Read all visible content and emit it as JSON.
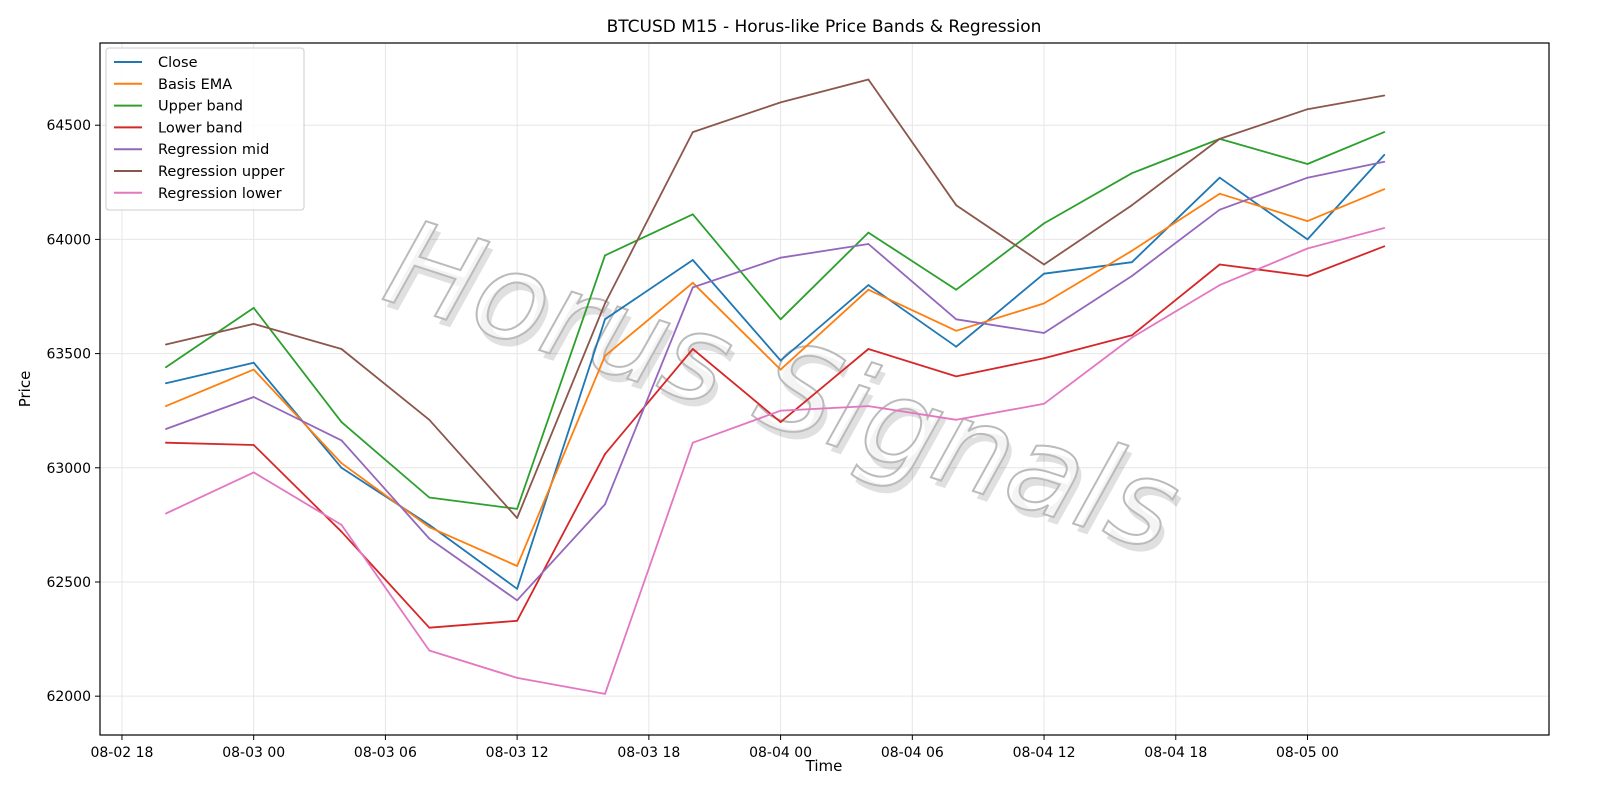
{
  "chart_data": {
    "type": "line",
    "title": "BTCUSD M15 - Horus-like Price Bands & Regression",
    "xlabel": "Time",
    "ylabel": "Price",
    "xlim": [
      "08-02 17:00",
      "08-05 11:00"
    ],
    "ylim": [
      61830,
      64860
    ],
    "x_ticks": [
      "08-02 18",
      "08-03 00",
      "08-03 06",
      "08-03 12",
      "08-03 18",
      "08-04 00",
      "08-04 06",
      "08-04 12",
      "08-04 18",
      "08-05 00"
    ],
    "y_ticks": [
      62000,
      62500,
      63000,
      63500,
      64000,
      64500
    ],
    "grid": true,
    "legend_position": "top-left",
    "watermark": "Horus Signals",
    "x": [
      "08-02 20:00",
      "08-03 00:00",
      "08-03 04:00",
      "08-03 08:00",
      "08-03 12:00",
      "08-03 16:00",
      "08-03 20:00",
      "08-04 00:00",
      "08-04 04:00",
      "08-04 08:00",
      "08-04 12:00",
      "08-04 16:00",
      "08-04 20:00",
      "08-05 00:00",
      "08-05 03:30"
    ],
    "series": [
      {
        "name": "Close",
        "color": "#1f77b4",
        "values": [
          63370,
          63460,
          63000,
          62750,
          62470,
          63650,
          63910,
          63470,
          63800,
          63530,
          63850,
          63900,
          64270,
          64000,
          64370
        ]
      },
      {
        "name": "Basis EMA",
        "color": "#ff7f0e",
        "values": [
          63270,
          63430,
          63020,
          62740,
          62570,
          63490,
          63810,
          63430,
          63780,
          63600,
          63720,
          63950,
          64200,
          64080,
          64220
        ]
      },
      {
        "name": "Upper band",
        "color": "#2ca02c",
        "values": [
          63440,
          63700,
          63200,
          62870,
          62820,
          63930,
          64110,
          63650,
          64030,
          63780,
          64070,
          64290,
          64440,
          64330,
          64470
        ]
      },
      {
        "name": "Lower band",
        "color": "#d62728",
        "values": [
          63110,
          63100,
          62720,
          62300,
          62330,
          63060,
          63520,
          63200,
          63520,
          63400,
          63480,
          63580,
          63890,
          63840,
          63970
        ]
      },
      {
        "name": "Regression mid",
        "color": "#9467bd",
        "values": [
          63170,
          63310,
          63120,
          62690,
          62420,
          62840,
          63790,
          63920,
          63980,
          63650,
          63590,
          63840,
          64130,
          64270,
          64340
        ]
      },
      {
        "name": "Regression upper",
        "color": "#8c564b",
        "values": [
          63540,
          63630,
          63520,
          63210,
          62780,
          63720,
          64470,
          64600,
          64700,
          64150,
          63890,
          64150,
          64440,
          64570,
          64630
        ]
      },
      {
        "name": "Regression lower",
        "color": "#e377c2",
        "values": [
          62800,
          62980,
          62750,
          62200,
          62080,
          62010,
          63110,
          63250,
          63270,
          63210,
          63280,
          63570,
          63800,
          63960,
          64050
        ]
      }
    ]
  }
}
